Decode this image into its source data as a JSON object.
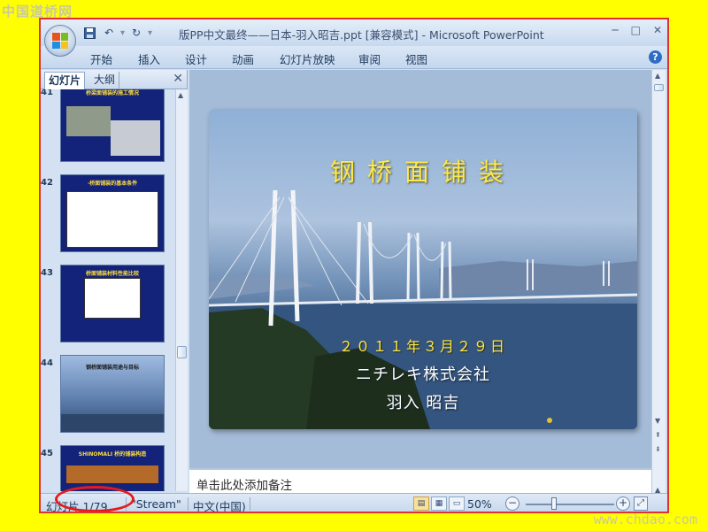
{
  "watermarks": {
    "top_left": "中国道桥网",
    "bottom_right": "www.chdao.com"
  },
  "window": {
    "title": "版PP中文最终——日本-羽入昭吉.ppt [兼容模式] - Microsoft PowerPoint",
    "controls": [
      "─",
      "□",
      "✕"
    ]
  },
  "quick_access": {
    "save_icon": "save-icon",
    "undo_icon": "undo-icon",
    "redo_icon": "redo-icon",
    "customize_icon": "customize-icon"
  },
  "ribbon": {
    "tabs": [
      "开始",
      "插入",
      "设计",
      "动画",
      "幻灯片放映",
      "审阅",
      "视图"
    ],
    "help": "?"
  },
  "left_pane": {
    "tabs": [
      "幻灯片",
      "大纲"
    ],
    "close": "✕",
    "slides": [
      {
        "number": "41",
        "title": "桥梁面铺装的施工情况",
        "bg": "#14237a"
      },
      {
        "number": "42",
        "title": "·桥面铺装的基本条件",
        "bg": "#14237a"
      },
      {
        "number": "43",
        "title": "桥面铺装材料性能比较",
        "bg": "#14237a"
      },
      {
        "number": "44",
        "title": "钢桥面铺装用途与目标",
        "bg": "#6c8fbf"
      },
      {
        "number": "45",
        "title": "SHINOMALI 桥的铺装构造",
        "bg": "#14237a"
      }
    ]
  },
  "slide": {
    "title": "钢桥面铺装",
    "date": "２０１１年３月２９日",
    "company": "ニチレキ株式会社",
    "person": "羽入 昭吉"
  },
  "notes": {
    "placeholder": "单击此处添加备注"
  },
  "status_bar": {
    "slide_counter": "幻灯片 1/79",
    "theme": "\"Stream\"",
    "language": "中文(中国)",
    "zoom_level": "50%",
    "zoom_fraction": 0.32
  },
  "colors": {
    "annotation_ring": "#e41b1b",
    "accent_yellow": "#ffe94a",
    "frame_red": "#e03030"
  }
}
